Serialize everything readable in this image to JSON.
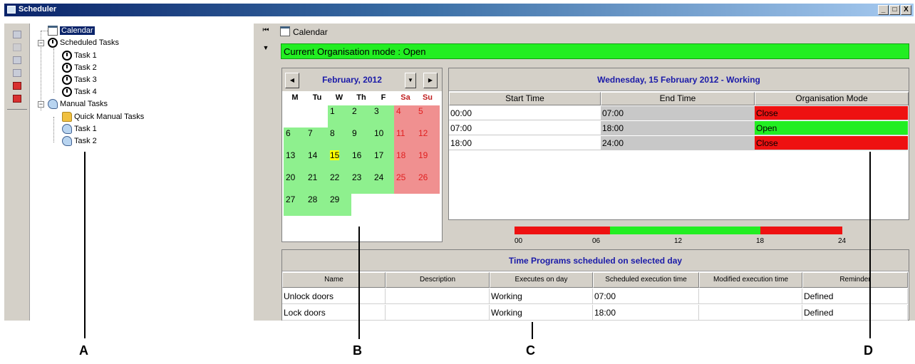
{
  "window": {
    "title": "Scheduler",
    "controls": [
      "_",
      "□",
      "X"
    ]
  },
  "tree": {
    "root_label": "Calendar",
    "scheduled_label": "Scheduled Tasks",
    "scheduled_items": [
      "Task 1",
      "Task 2",
      "Task 3",
      "Task 4"
    ],
    "manual_label": "Manual Tasks",
    "manual_items": [
      "Quick Manual Tasks",
      "Task 1",
      "Task 2"
    ]
  },
  "header": {
    "title": "Calendar",
    "org_mode_text": "Current Organisation mode : Open"
  },
  "calendar": {
    "month_label": "February, 2012",
    "weekdays": [
      "M",
      "Tu",
      "W",
      "Th",
      "F",
      "Sa",
      "Su"
    ],
    "today": 15,
    "colors": {
      "working": "#8ef08e",
      "weekend": "#f09090",
      "today": "#ffff00"
    }
  },
  "day_table": {
    "title": "Wednesday, 15 February 2012 - Working",
    "columns": [
      "Start Time",
      "End Time",
      "Organisation Mode"
    ],
    "rows": [
      {
        "start": "00:00",
        "end": "07:00",
        "mode": "Close",
        "mode_color": "#ee1111"
      },
      {
        "start": "07:00",
        "end": "18:00",
        "mode": "Open",
        "mode_color": "#22ee22"
      },
      {
        "start": "18:00",
        "end": "24:00",
        "mode": "Close",
        "mode_color": "#ee1111"
      }
    ]
  },
  "timeline": {
    "ticks": [
      "00",
      "06",
      "12",
      "18",
      "24"
    ],
    "segments": [
      {
        "from_hour": 0,
        "to_hour": 7,
        "color": "#ee1111"
      },
      {
        "from_hour": 7,
        "to_hour": 18,
        "color": "#22ee22"
      },
      {
        "from_hour": 18,
        "to_hour": 24,
        "color": "#ee1111"
      }
    ]
  },
  "programs": {
    "title": "Time Programs scheduled on selected day",
    "columns": [
      "Name",
      "Description",
      "Executes on day",
      "Scheduled execution time",
      "Modified execution time",
      "Reminder"
    ],
    "rows": [
      [
        "Unlock doors",
        "",
        "Working",
        "07:00",
        "",
        "Defined"
      ],
      [
        "Lock doors",
        "",
        "Working",
        "18:00",
        "",
        "Defined"
      ]
    ]
  },
  "callouts": [
    "A",
    "B",
    "C",
    "D"
  ]
}
